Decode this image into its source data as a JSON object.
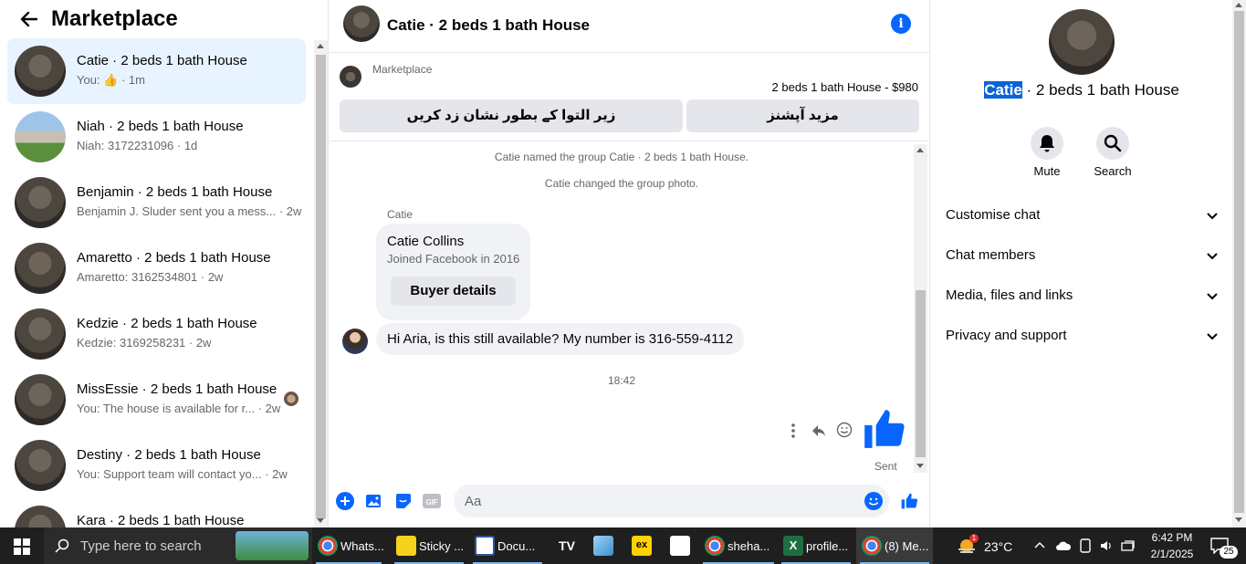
{
  "left": {
    "title": "Marketplace",
    "conversations": [
      {
        "name": "Catie · 2 beds 1 bath House",
        "preview": "You: 👍 · 1m"
      },
      {
        "name": "Niah · 2 beds 1 bath House",
        "preview": "Niah: 3172231096 · 1d"
      },
      {
        "name": "Benjamin · 2 beds 1 bath House",
        "preview": "Benjamin J. Sluder sent you a mess... · 2w"
      },
      {
        "name": "Amaretto · 2 beds 1 bath House",
        "preview": "Amaretto: 3162534801 · 2w"
      },
      {
        "name": "Kedzie · 2 beds 1 bath House",
        "preview": "Kedzie: 3169258231 · 2w"
      },
      {
        "name": "MissEssie · 2 beds 1 bath House",
        "preview": "You: The house is available for r... · 2w"
      },
      {
        "name": "Destiny · 2 beds 1 bath House",
        "preview": "You: Support team will contact yo... · 2w"
      },
      {
        "name": "Kara · 2 beds 1 bath House",
        "preview": ""
      }
    ]
  },
  "chat": {
    "title": "Catie · 2 beds 1 bath House",
    "marketplace_label": "Marketplace",
    "listing": "2 beds 1 bath House - $980",
    "mark_pending_button": "زیر التوا کے بطور نشان زد کریں",
    "more_options_button": "مزید آپشنز",
    "system_messages": [
      "Catie named the group Catie · 2 beds 1 bath House.",
      "Catie changed the group photo."
    ],
    "sender": "Catie",
    "card_name": "Catie Collins",
    "card_sub": "Joined Facebook in 2016",
    "buyer_details_button": "Buyer details",
    "message": "Hi Aria, is this still available? My number is 316-559-4112",
    "time": "18:42",
    "sent_status": "Sent",
    "input_placeholder": "Aa"
  },
  "right": {
    "name_highlight": "Catie",
    "name_rest": " · 2 beds 1 bath House",
    "mute_label": "Mute",
    "search_label": "Search",
    "sections": [
      "Customise chat",
      "Chat members",
      "Media, files and links",
      "Privacy and support"
    ]
  },
  "taskbar": {
    "search_placeholder": "Type here to search",
    "apps": [
      {
        "label": "Whats...",
        "icon": "chrome-icon"
      },
      {
        "label": "Sticky ...",
        "icon": "sticky-notes-icon"
      },
      {
        "label": "Docu...",
        "icon": "document-icon"
      },
      {
        "label": "",
        "icon": "tradingview-icon"
      },
      {
        "label": "",
        "icon": "notepad-icon"
      },
      {
        "label": "",
        "icon": "exness-icon"
      },
      {
        "label": "",
        "icon": "file-icon"
      },
      {
        "label": "sheha...",
        "icon": "chrome-icon"
      },
      {
        "label": "profile...",
        "icon": "excel-icon"
      },
      {
        "label": "(8) Me...",
        "icon": "chrome-icon"
      }
    ],
    "weather": "23°C",
    "weather_badge": "1",
    "time": "6:42 PM",
    "date": "2/1/2025",
    "notification_count": "25"
  },
  "colors": {
    "accent": "#0866ff",
    "active_conv": "#e7f3ff",
    "taskbar": "#1f1f1f"
  }
}
